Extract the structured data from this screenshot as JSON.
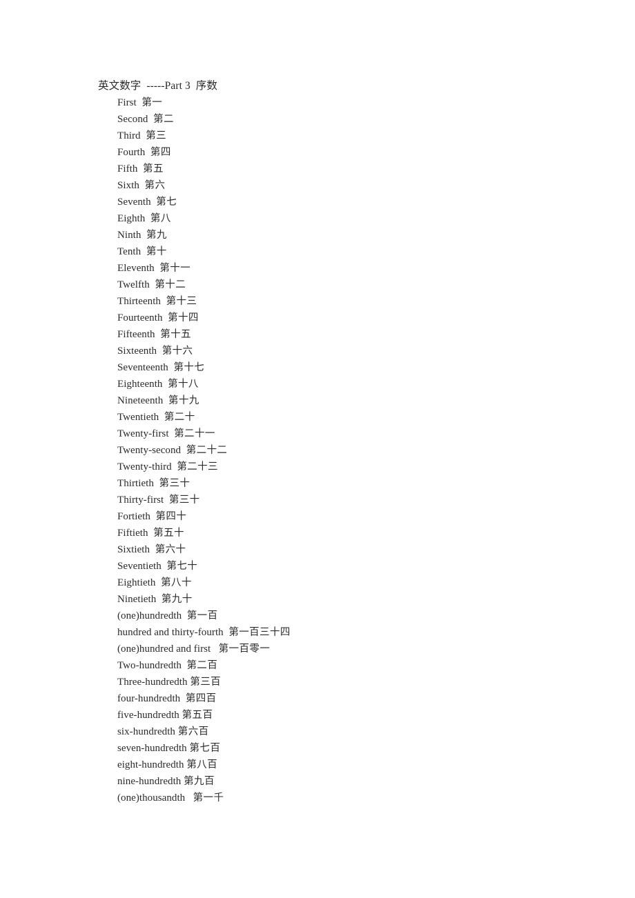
{
  "document": {
    "title": "英文数字  -----Part 3  序数",
    "background_color": "#ffffff",
    "text_color": "#2b2b2b"
  },
  "ordinals": [
    {
      "english": "First",
      "gap": "  ",
      "chinese": "第一"
    },
    {
      "english": "Second",
      "gap": "  ",
      "chinese": "第二"
    },
    {
      "english": "Third",
      "gap": "  ",
      "chinese": "第三"
    },
    {
      "english": "Fourth",
      "gap": "  ",
      "chinese": "第四"
    },
    {
      "english": "Fifth",
      "gap": "  ",
      "chinese": "第五"
    },
    {
      "english": "Sixth",
      "gap": "  ",
      "chinese": "第六"
    },
    {
      "english": "Seventh",
      "gap": "  ",
      "chinese": "第七"
    },
    {
      "english": "Eighth",
      "gap": "  ",
      "chinese": "第八"
    },
    {
      "english": "Ninth",
      "gap": "  ",
      "chinese": "第九"
    },
    {
      "english": "Tenth",
      "gap": "  ",
      "chinese": "第十"
    },
    {
      "english": "Eleventh",
      "gap": "  ",
      "chinese": "第十一"
    },
    {
      "english": "Twelfth",
      "gap": "  ",
      "chinese": "第十二"
    },
    {
      "english": "Thirteenth",
      "gap": "  ",
      "chinese": "第十三"
    },
    {
      "english": "Fourteenth",
      "gap": "  ",
      "chinese": "第十四"
    },
    {
      "english": "Fifteenth",
      "gap": "  ",
      "chinese": "第十五"
    },
    {
      "english": "Sixteenth",
      "gap": "  ",
      "chinese": "第十六"
    },
    {
      "english": "Seventeenth",
      "gap": "  ",
      "chinese": "第十七"
    },
    {
      "english": "Eighteenth",
      "gap": "  ",
      "chinese": "第十八"
    },
    {
      "english": "Nineteenth",
      "gap": "  ",
      "chinese": "第十九"
    },
    {
      "english": "Twentieth",
      "gap": "  ",
      "chinese": "第二十"
    },
    {
      "english": "Twenty-first",
      "gap": "  ",
      "chinese": "第二十一"
    },
    {
      "english": "Twenty-second",
      "gap": "  ",
      "chinese": "第二十二"
    },
    {
      "english": "Twenty-third",
      "gap": "  ",
      "chinese": "第二十三"
    },
    {
      "english": "Thirtieth",
      "gap": "  ",
      "chinese": "第三十"
    },
    {
      "english": "Thirty-first",
      "gap": "  ",
      "chinese": "第三十"
    },
    {
      "english": "Fortieth",
      "gap": "  ",
      "chinese": "第四十"
    },
    {
      "english": "Fiftieth",
      "gap": "  ",
      "chinese": "第五十"
    },
    {
      "english": "Sixtieth",
      "gap": "  ",
      "chinese": "第六十"
    },
    {
      "english": "Seventieth",
      "gap": "  ",
      "chinese": "第七十"
    },
    {
      "english": "Eightieth",
      "gap": "  ",
      "chinese": "第八十"
    },
    {
      "english": "Ninetieth",
      "gap": "  ",
      "chinese": "第九十"
    },
    {
      "english": "(one)hundredth",
      "gap": "  ",
      "chinese": "第一百"
    },
    {
      "english": "hundred and thirty-fourth",
      "gap": "  ",
      "chinese": "第一百三十四"
    },
    {
      "english": "(one)hundred and first",
      "gap": "   ",
      "chinese": "第一百零一"
    },
    {
      "english": "Two-hundredth",
      "gap": "  ",
      "chinese": "第二百"
    },
    {
      "english": "Three-hundredth",
      "gap": " ",
      "chinese": "第三百"
    },
    {
      "english": "four-hundredth",
      "gap": "  ",
      "chinese": "第四百"
    },
    {
      "english": "five-hundredth",
      "gap": " ",
      "chinese": "第五百"
    },
    {
      "english": "six-hundredth",
      "gap": " ",
      "chinese": "第六百"
    },
    {
      "english": "seven-hundredth",
      "gap": " ",
      "chinese": "第七百"
    },
    {
      "english": "eight-hundredth",
      "gap": " ",
      "chinese": "第八百"
    },
    {
      "english": "nine-hundredth",
      "gap": " ",
      "chinese": "第九百"
    },
    {
      "english": "(one)thousandth",
      "gap": "   ",
      "chinese": "第一千"
    }
  ]
}
